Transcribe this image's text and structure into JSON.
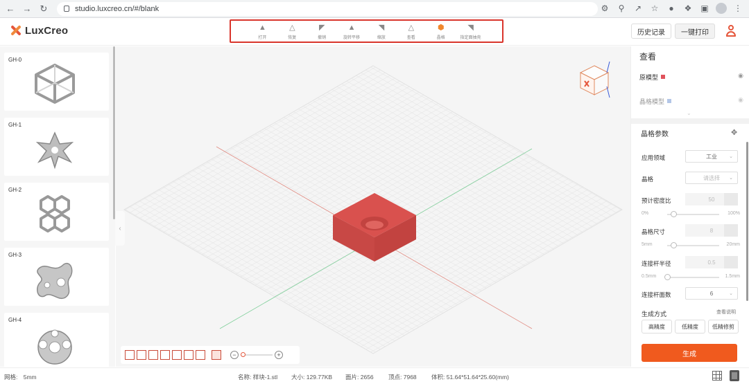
{
  "browser": {
    "url": "studio.luxcreo.cn/#/blank"
  },
  "app": {
    "brand": "LuxCreo",
    "toolbar": [
      {
        "label": "打开",
        "icon": "open-file-icon",
        "accent": true
      },
      {
        "label": "恢复",
        "icon": "restore-icon",
        "accent": false
      },
      {
        "label": "撤销",
        "icon": "undo-icon",
        "accent": false
      },
      {
        "label": "旋转平移",
        "icon": "rotate-move-icon",
        "accent": false
      },
      {
        "label": "缩放",
        "icon": "scale-icon",
        "accent": false
      },
      {
        "label": "查看",
        "icon": "view-icon",
        "accent": false
      },
      {
        "label": "晶格",
        "icon": "lattice-icon",
        "accent": true
      },
      {
        "label": "指定面抽壳",
        "icon": "shell-face-icon",
        "accent": false
      }
    ],
    "history_label": "历史记录",
    "print_label": "一键打印"
  },
  "library": {
    "items": [
      {
        "label": "GH-0"
      },
      {
        "label": "GH-1"
      },
      {
        "label": "GH-2"
      },
      {
        "label": "GH-3"
      },
      {
        "label": "GH-4"
      }
    ]
  },
  "view_panel": {
    "title": "查看",
    "original_model": {
      "label": "原模型",
      "color": "#e0525c"
    },
    "lattice_model": {
      "label": "晶格模型",
      "color": "#6a8fd1"
    }
  },
  "params": {
    "title": "晶格参数",
    "application_label": "应用领域",
    "application_value": "工业",
    "lattice_label": "晶格",
    "lattice_placeholder": "请选择",
    "density_label": "预计密度比",
    "density_value": "50",
    "density_min": "0%",
    "density_max": "100%",
    "density_fraction": 0.12,
    "cell_size_label": "晶格尺寸",
    "cell_size_value": "8",
    "cell_size_min": "5mm",
    "cell_size_max": "20mm",
    "cell_size_fraction": 0.12,
    "radius_label": "连接杆半径",
    "radius_value": "0.5",
    "radius_min": "0.5mm",
    "radius_max": "1.5mm",
    "radius_fraction": 0.0,
    "rod_faces_label": "连接杆面数",
    "rod_faces_value": "6",
    "gen_mode_label": "生成方式",
    "explain_label": "查看说明",
    "modes": [
      "高精度",
      "低精度",
      "低精修剪"
    ],
    "generate_label": "生成"
  },
  "status": {
    "grid_label": "网格:",
    "grid_value": "5mm",
    "name_label": "名称:",
    "name_value": "样块-1.stl",
    "size_label": "大小:",
    "size_value": "129.77KB",
    "faces_label": "面片:",
    "faces_value": "2656",
    "vertices_label": "顶点:",
    "vertices_value": "7968",
    "volume_label": "体积:",
    "volume_value": "51.64*51.64*25.60(mm)"
  },
  "colors": {
    "accent": "#f05a1e",
    "model": "#d9514e",
    "highlight_box": "#d9342b"
  }
}
